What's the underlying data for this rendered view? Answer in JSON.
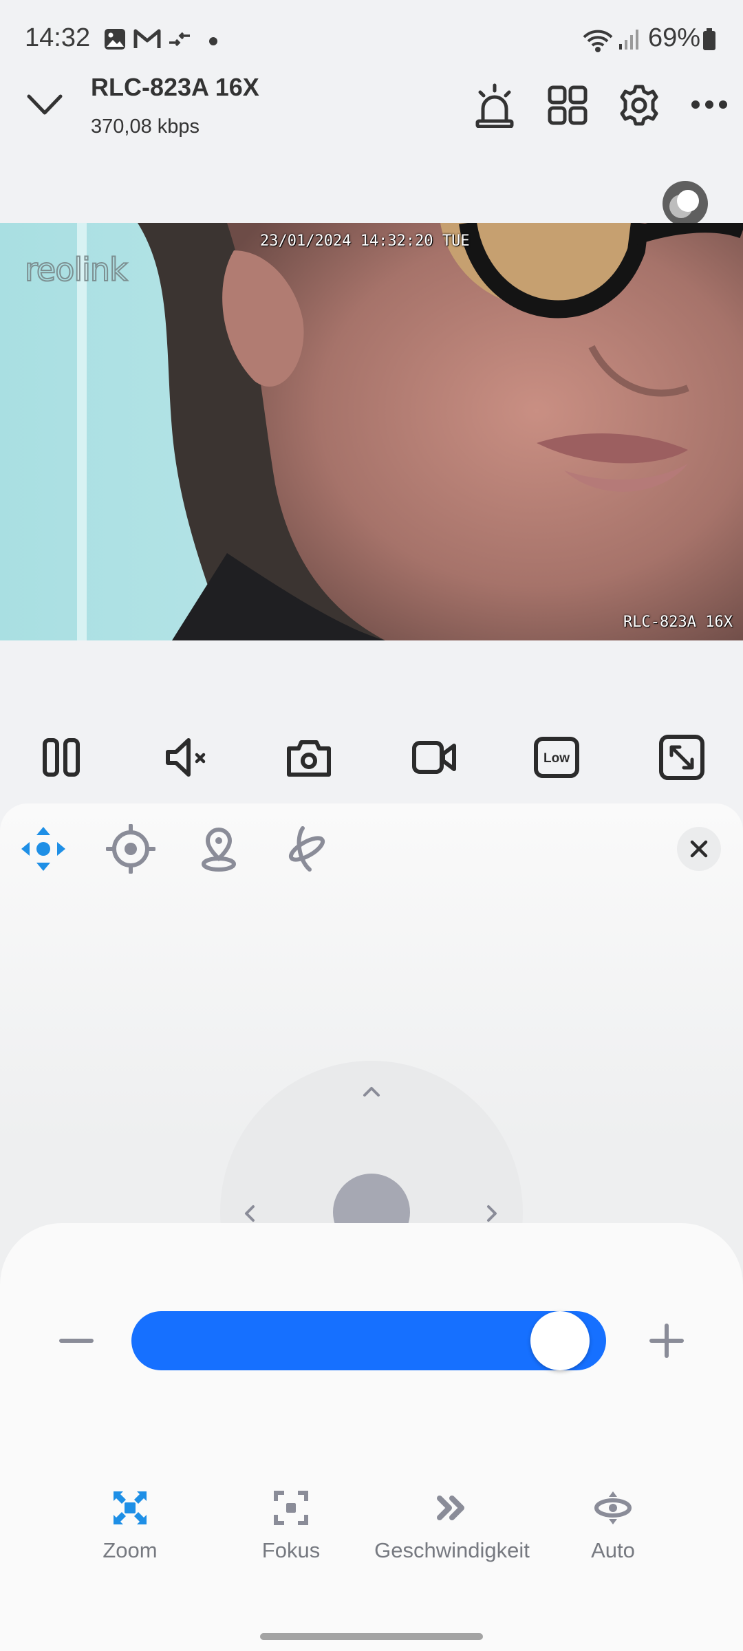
{
  "status_bar": {
    "time": "14:32",
    "battery": "69%"
  },
  "header": {
    "title": "RLC-823A 16X",
    "bitrate": "370,08 kbps"
  },
  "video": {
    "timestamp": "23/01/2024 14:32:20 TUE",
    "camera_label": "RLC-823A 16X",
    "brand_logo": "reolink"
  },
  "controls": {
    "quality_label": "Low"
  },
  "ptz_modes": [
    {
      "label": "Zoom",
      "icon": "zoom-icon",
      "active": true
    },
    {
      "label": "Fokus",
      "icon": "focus-icon",
      "active": false
    },
    {
      "label": "Geschwindigkeit",
      "icon": "speed-icon",
      "active": false
    },
    {
      "label": "Auto",
      "icon": "auto-icon",
      "active": false
    }
  ],
  "zoom": {
    "level": 0.96
  },
  "colors": {
    "accent": "#1670ff",
    "active_icon": "#1e8fe6",
    "icon": "#8a8c98"
  }
}
